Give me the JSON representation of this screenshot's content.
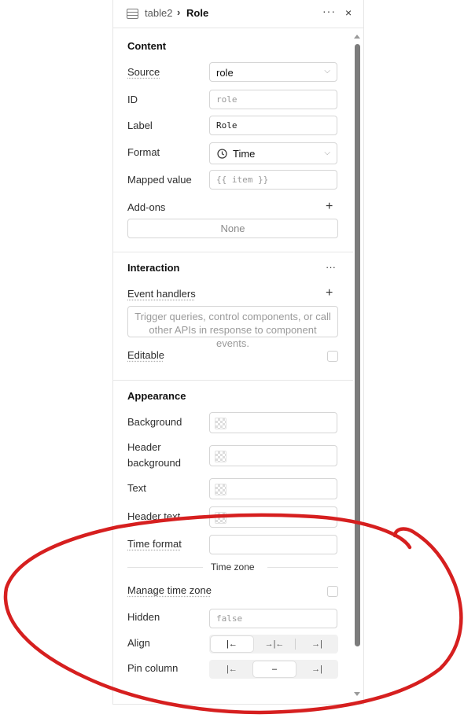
{
  "header": {
    "component": "table2",
    "separator": "›",
    "name": "Role",
    "more": "···",
    "close": "×"
  },
  "content": {
    "title": "Content",
    "source_label": "Source",
    "source_value": "role",
    "id_label": "ID",
    "id_placeholder": "role",
    "label_label": "Label",
    "label_value": "Role",
    "format_label": "Format",
    "format_value": "Time",
    "mapped_label": "Mapped value",
    "mapped_placeholder": "{{ item }}",
    "addons_label": "Add-ons",
    "addons_value": "None"
  },
  "interaction": {
    "title": "Interaction",
    "more": "···",
    "event_label": "Event handlers",
    "event_placeholder_line1": "Trigger queries, control components, or call",
    "event_placeholder_line2": "other APIs in response to component events.",
    "editable_label": "Editable"
  },
  "appearance": {
    "title": "Appearance",
    "background_label": "Background",
    "header_bg_label_1": "Header",
    "header_bg_label_2": "background",
    "text_label": "Text",
    "header_text_label": "Header text",
    "time_format_label": "Time format",
    "time_zone_divider": "Time zone",
    "manage_tz_label": "Manage time zone",
    "hidden_label": "Hidden",
    "hidden_placeholder": "false",
    "align_label": "Align",
    "pin_label": "Pin column",
    "align_options": [
      "|←",
      "→|←",
      "→|"
    ],
    "align_selected": 0,
    "pin_options": [
      "|←",
      "–",
      "→|"
    ],
    "pin_selected": 1
  },
  "annotation": {
    "color": "#d61f1f",
    "shape": "red-hand-drawn-ellipse"
  }
}
